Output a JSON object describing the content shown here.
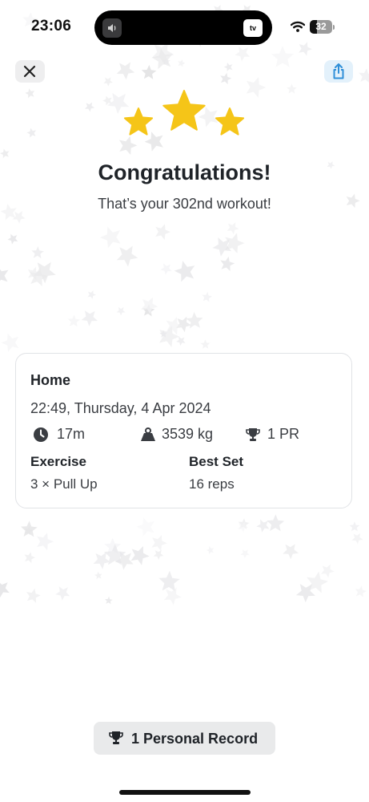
{
  "status_bar": {
    "time": "23:06",
    "tv_badge": "tv",
    "battery_level": "32",
    "battery_fraction": 0.32
  },
  "header": {
    "close_icon": "close-icon",
    "share_icon": "share-icon"
  },
  "celebration": {
    "stars_icon": "star-icon",
    "rating": 3,
    "title": "Congratulations!",
    "subtitle": "That’s your 302nd workout!",
    "accent_color": "#f5c518"
  },
  "workout": {
    "name": "Home",
    "datetime": "22:49, Thursday, 4 Apr 2024",
    "duration": "17m",
    "volume": "3539 kg",
    "records": "1 PR",
    "exercise_header": "Exercise",
    "best_set_header": "Best Set",
    "exercises": [
      {
        "name": "3 × Pull Up",
        "best_set": "16 reps"
      }
    ]
  },
  "footer": {
    "personal_record_label": "1 Personal Record"
  }
}
